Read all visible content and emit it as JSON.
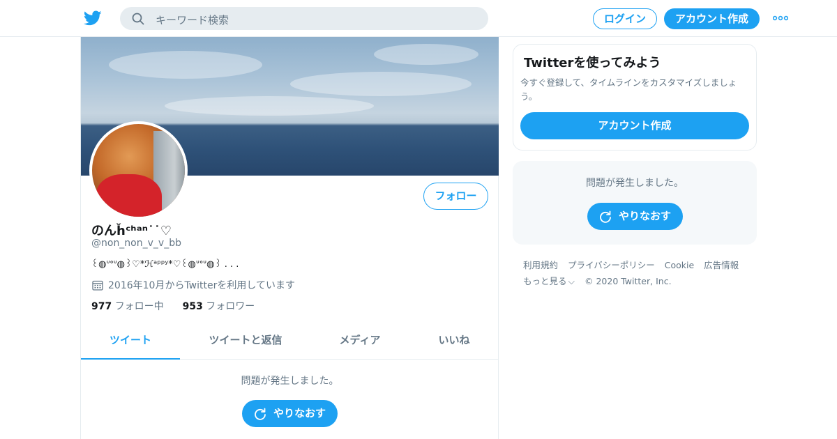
{
  "colors": {
    "accent": "#1da1f2",
    "text": "#14171a",
    "muted": "#657786",
    "border": "#e6ecf0"
  },
  "header": {
    "logo_icon": "twitter-bird-icon",
    "search_placeholder": "キーワード検索",
    "login_label": "ログイン",
    "signup_label": "アカウント作成",
    "more_icon": "more-dots-icon"
  },
  "profile": {
    "name": "のんȟᶜʰᵃⁿ˙˙♡",
    "handle": "@non_non_v_v_bb",
    "bio": "꒰◍ᐡᐤᐡ◍꒱♡*ℋᵃᵖᵖʸ*♡꒰◍ᐡᐤᐡ◍꒱ . . .",
    "joined": "2016年10月からTwitterを利用しています",
    "following_count": "977",
    "following_label": "フォロー中",
    "followers_count": "953",
    "followers_label": "フォロワー",
    "follow_label": "フォロー"
  },
  "tabs": [
    {
      "label": "ツイート",
      "active": true
    },
    {
      "label": "ツイートと返信",
      "active": false
    },
    {
      "label": "メディア",
      "active": false
    },
    {
      "label": "いいね",
      "active": false
    }
  ],
  "timeline": {
    "error_message": "問題が発生しました。",
    "retry_label": "やりなおす"
  },
  "signup_card": {
    "title": "Twitterを使ってみよう",
    "subtitle": "今すぐ登録して、タイムラインをカスタマイズしましょう。",
    "button_label": "アカウント作成"
  },
  "sidebar_error": {
    "error_message": "問題が発生しました。",
    "retry_label": "やりなおす"
  },
  "footer": {
    "links": [
      "利用規約",
      "プライバシーポリシー",
      "Cookie",
      "広告情報"
    ],
    "more_label": "もっと見る",
    "copyright": "© 2020 Twitter, Inc."
  }
}
